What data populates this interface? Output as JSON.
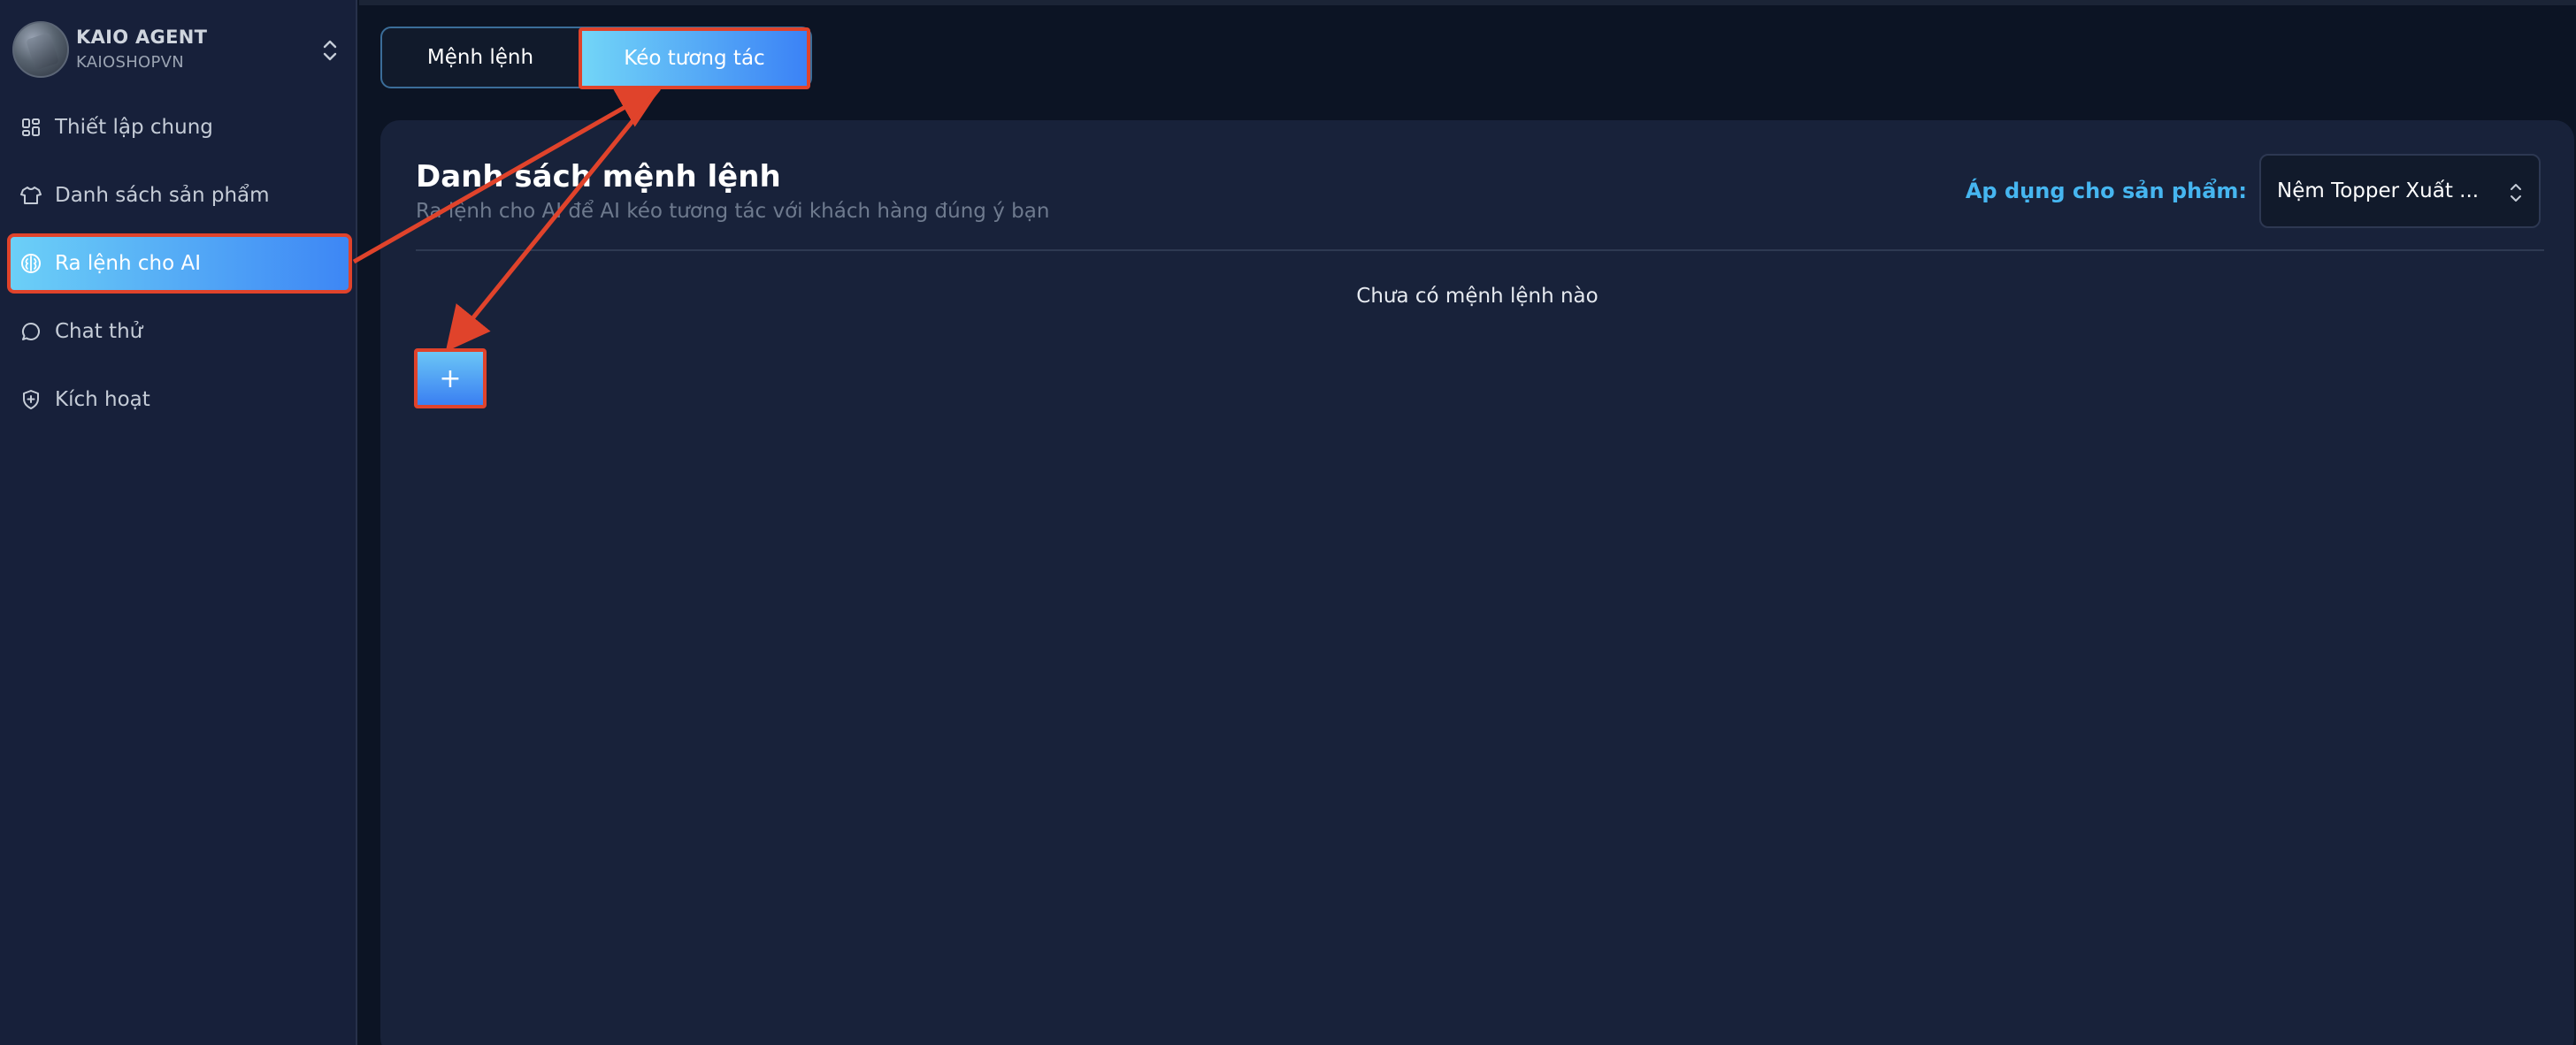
{
  "profile": {
    "name": "KAIO AGENT",
    "handle": "KAIOSHOPVN"
  },
  "sidebar": {
    "items": [
      {
        "label": "Thiết lập chung",
        "icon": "grid-icon",
        "active": false
      },
      {
        "label": "Danh sách sản phẩm",
        "icon": "shirt-icon",
        "active": false
      },
      {
        "label": "Ra lệnh cho AI",
        "icon": "brain-icon",
        "active": true
      },
      {
        "label": "Chat thử",
        "icon": "chat-bubble-icon",
        "active": false
      },
      {
        "label": "Kích hoạt",
        "icon": "shield-plus-icon",
        "active": false
      }
    ]
  },
  "tabs": [
    {
      "label": "Mệnh lệnh",
      "active": false
    },
    {
      "label": "Kéo tương tác",
      "active": true
    }
  ],
  "main": {
    "title": "Danh sách mệnh lệnh",
    "subtitle": "Ra lệnh cho AI để AI kéo tương tác với khách hàng đúng ý bạn",
    "apply_label": "Áp dụng cho sản phẩm:",
    "product_select_value": "Nệm Topper Xuất ...",
    "empty_text": "Chưa có mệnh lệnh nào",
    "add_button_label": "+"
  },
  "colors": {
    "accent_gradient_start": "#6cd0f7",
    "accent_gradient_end": "#3d86f5",
    "highlight_annotation": "#e0432b",
    "apply_label": "#46b6f0"
  }
}
